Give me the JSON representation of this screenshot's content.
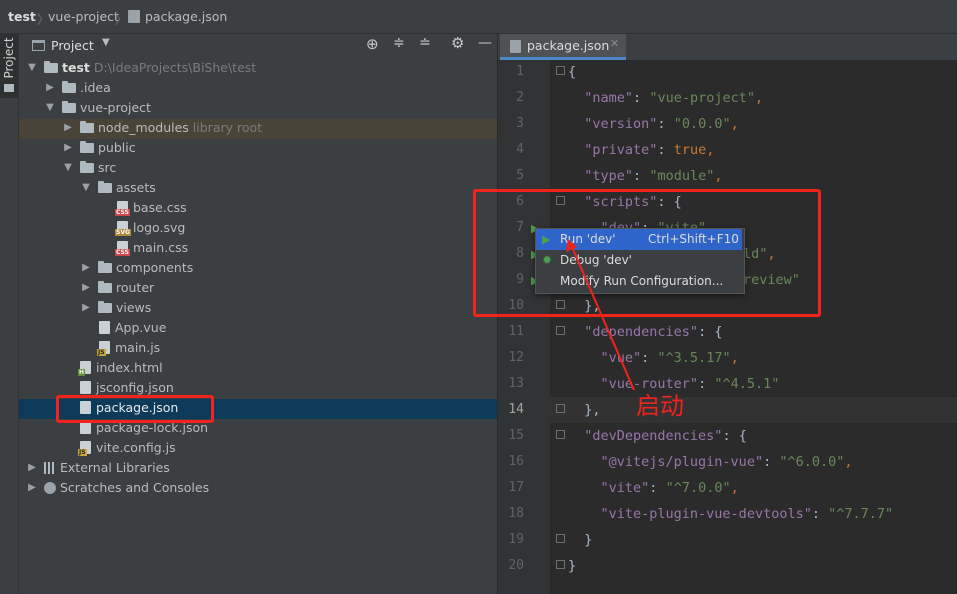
{
  "breadcrumb": {
    "root": "test",
    "folder": "vue-project",
    "file": "package.json"
  },
  "sidebar": {
    "stripe_label": "Project"
  },
  "panel": {
    "title": "Project"
  },
  "tree": [
    {
      "label": "test",
      "extra": "D:\\IdeaProjects\\BiShe\\test"
    },
    {
      "label": ".idea"
    },
    {
      "label": "vue-project"
    },
    {
      "label": "node_modules",
      "extra": "library root"
    },
    {
      "label": "public"
    },
    {
      "label": "src"
    },
    {
      "label": "assets"
    },
    {
      "label": "base.css"
    },
    {
      "label": "logo.svg"
    },
    {
      "label": "main.css"
    },
    {
      "label": "components"
    },
    {
      "label": "router"
    },
    {
      "label": "views"
    },
    {
      "label": "App.vue"
    },
    {
      "label": "main.js"
    },
    {
      "label": "index.html"
    },
    {
      "label": "jsconfig.json"
    },
    {
      "label": "package.json"
    },
    {
      "label": "package-lock.json"
    },
    {
      "label": "vite.config.js"
    },
    {
      "label": "External Libraries"
    },
    {
      "label": "Scratches and Consoles"
    }
  ],
  "editor": {
    "tab_label": "package.json",
    "line_numbers": [
      "1",
      "2",
      "3",
      "4",
      "5",
      "6",
      "7",
      "8",
      "9",
      "10",
      "11",
      "12",
      "13",
      "14",
      "15",
      "16",
      "17",
      "18",
      "19",
      "20"
    ],
    "code": {
      "l1": "{",
      "l2k": "\"name\"",
      "l2v": "\"vue-project\"",
      "l3k": "\"version\"",
      "l3v": "\"0.0.0\"",
      "l4k": "\"private\"",
      "l4v": "true",
      "l5k": "\"type\"",
      "l5v": "\"module\"",
      "l6k": "\"scripts\"",
      "l7k": "\"dev\"",
      "l7v": "\"vite\"",
      "l8v": "ld\"",
      "l9v": "review\"",
      "l10": "},",
      "l11k": "\"dependencies\"",
      "l12k": "\"vue\"",
      "l12v": "\"^3.5.17\"",
      "l13k": "\"vue-router\"",
      "l13v": "\"^4.5.1\"",
      "l14": "},",
      "l15k": "\"devDependencies\"",
      "l16k": "\"@vitejs/plugin-vue\"",
      "l16v": "\"^6.0.0\"",
      "l17k": "\"vite\"",
      "l17v": "\"^7.0.0\"",
      "l18k": "\"vite-plugin-vue-devtools\"",
      "l18v": "\"^7.7.7\"",
      "l19": "}",
      "l20": "}"
    }
  },
  "popup": {
    "run_label": "Run 'dev'",
    "run_shortcut": "Ctrl+Shift+F10",
    "debug_label": "Debug 'dev'",
    "modify_label": "Modify Run Configuration..."
  },
  "annotation": {
    "text": "启动",
    "color": "#f2221c"
  }
}
